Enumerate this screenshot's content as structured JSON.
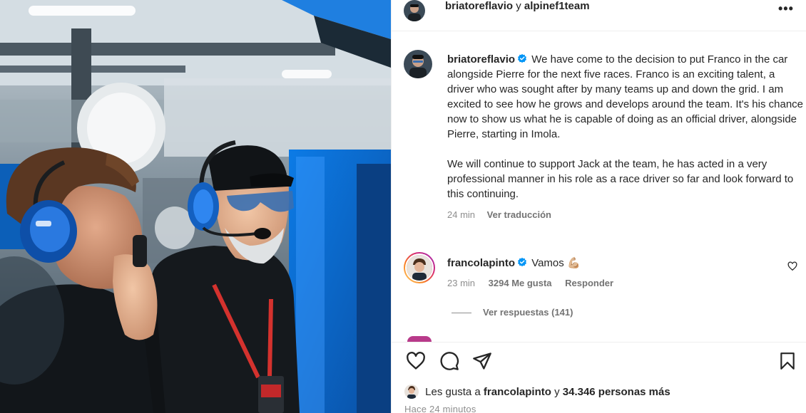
{
  "header": {
    "account_a": "briatoreflavio",
    "joiner": "y",
    "account_b": "alpinef1team",
    "more_label": "•••"
  },
  "caption": {
    "username": "briatoreflavio",
    "paragraph1": "We have come to the decision to put Franco in the car alongside Pierre for the next five races. Franco is an exciting talent, a driver who was sought after by many teams up and down the grid. I am excited to see how he grows and develops around the team. It's his chance now to show us what he is capable of doing as an official driver, alongside Pierre, starting in Imola.",
    "paragraph2": "We will continue to support Jack at the team, he has acted in a very professional manner in his role as a race driver so far and look forward to this continuing.",
    "time": "24 min",
    "translate_label": "Ver traducción"
  },
  "comment": {
    "username": "francolapinto",
    "text": "Vamos",
    "emoji": "💪🏼",
    "time": "23 min",
    "likes": "3294 Me gusta",
    "reply_label": "Responder"
  },
  "replies": {
    "label": "Ver respuestas (141)"
  },
  "likes": {
    "prefix": "Les gusta a",
    "user": "francolapinto",
    "joiner": "y",
    "others": "34.346 personas más"
  },
  "posted_ago": "Hace 24 minutos",
  "icons": {
    "like": "heart-icon",
    "comment": "comment-icon",
    "share": "share-icon",
    "save": "bookmark-icon",
    "verified": "verified-badge-icon",
    "more": "more-options-icon"
  },
  "colors": {
    "verified": "#0095f6",
    "text": "#262626",
    "muted": "#8e8e8e",
    "alpine_blue": "#0b6fd6"
  }
}
